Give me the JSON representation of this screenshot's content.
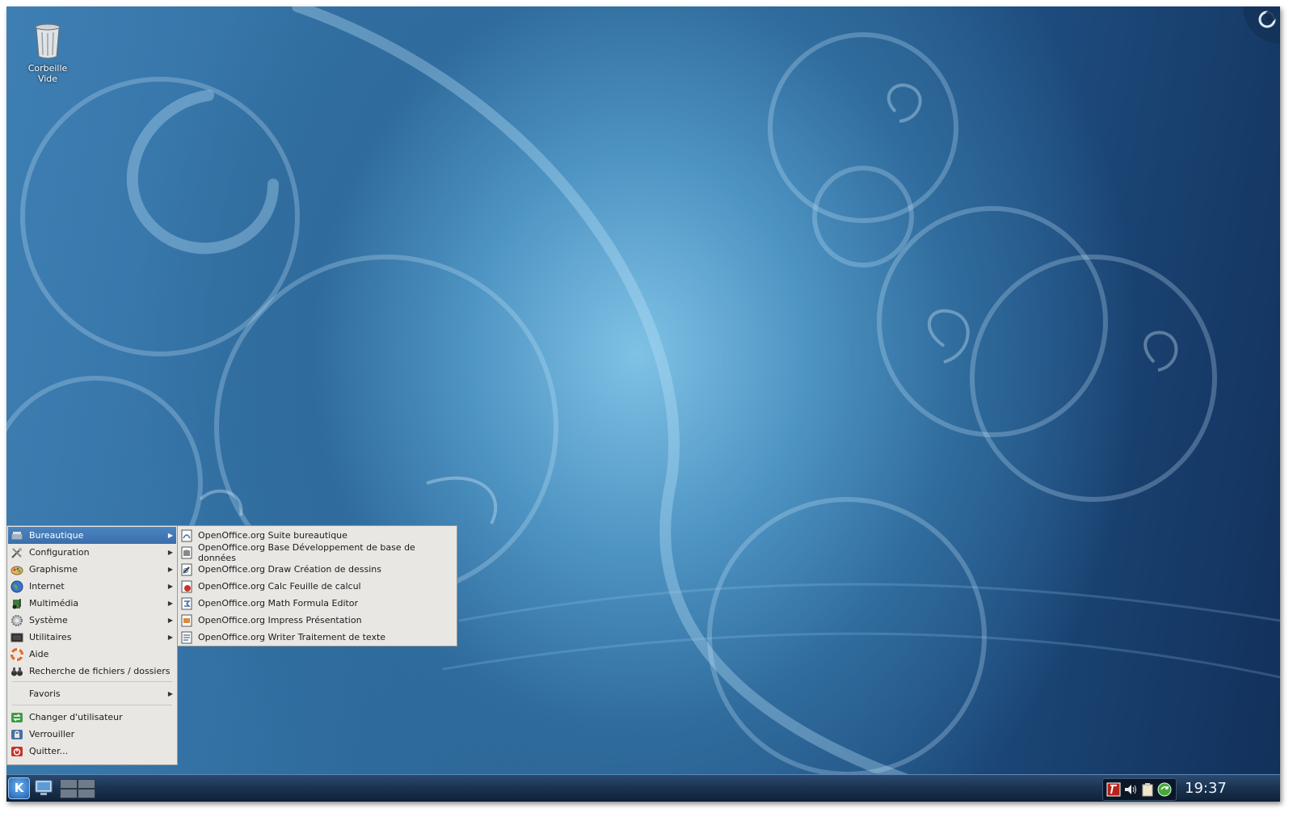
{
  "desktop": {
    "trash_icon": {
      "name": "trash-icon",
      "label_line1": "Corbeille",
      "label_line2": "Vide"
    }
  },
  "menu": {
    "items": [
      {
        "label": "Bureautique",
        "icon": "office-icon",
        "submenu": true,
        "active": true
      },
      {
        "label": "Configuration",
        "icon": "tools-icon",
        "submenu": true
      },
      {
        "label": "Graphisme",
        "icon": "graphics-icon",
        "submenu": true
      },
      {
        "label": "Internet",
        "icon": "globe-icon",
        "submenu": true
      },
      {
        "label": "Multimédia",
        "icon": "multimedia-icon",
        "submenu": true
      },
      {
        "label": "Système",
        "icon": "system-gear-icon",
        "submenu": true
      },
      {
        "label": "Utilitaires",
        "icon": "utilities-icon",
        "submenu": true
      },
      {
        "label": "Aide",
        "icon": "help-lifebuoy-icon",
        "submenu": false
      },
      {
        "label": "Recherche de fichiers / dossiers",
        "icon": "binoculars-icon",
        "submenu": false
      }
    ],
    "favorites": {
      "label": "Favoris",
      "submenu": true
    },
    "session_items": [
      {
        "label": "Changer d'utilisateur",
        "icon": "switch-user-icon"
      },
      {
        "label": "Verrouiller",
        "icon": "lock-icon"
      },
      {
        "label": "Quitter...",
        "icon": "quit-icon"
      }
    ]
  },
  "submenu": {
    "items": [
      {
        "label": "OpenOffice.org Suite bureautique",
        "icon": "openoffice-suite-icon"
      },
      {
        "label": "OpenOffice.org Base Développement de base de données",
        "icon": "openoffice-base-icon"
      },
      {
        "label": "OpenOffice.org Draw Création de dessins",
        "icon": "openoffice-draw-icon"
      },
      {
        "label": "OpenOffice.org Calc Feuille de calcul",
        "icon": "openoffice-calc-icon"
      },
      {
        "label": "OpenOffice.org Math Formula Editor",
        "icon": "openoffice-math-icon"
      },
      {
        "label": "OpenOffice.org Impress Présentation",
        "icon": "openoffice-impress-icon"
      },
      {
        "label": "OpenOffice.org Writer Traitement de texte",
        "icon": "openoffice-writer-icon"
      }
    ]
  },
  "taskbar": {
    "kmenu_glyph": "K",
    "tray_icons": [
      "ftp-icon",
      "volume-icon",
      "clipboard-icon",
      "update-icon"
    ],
    "clock": "19:37"
  },
  "colors": {
    "menu_bg": "#e8e7e4",
    "menu_active": "#3f78b8",
    "taskbar": "#1c3452"
  }
}
